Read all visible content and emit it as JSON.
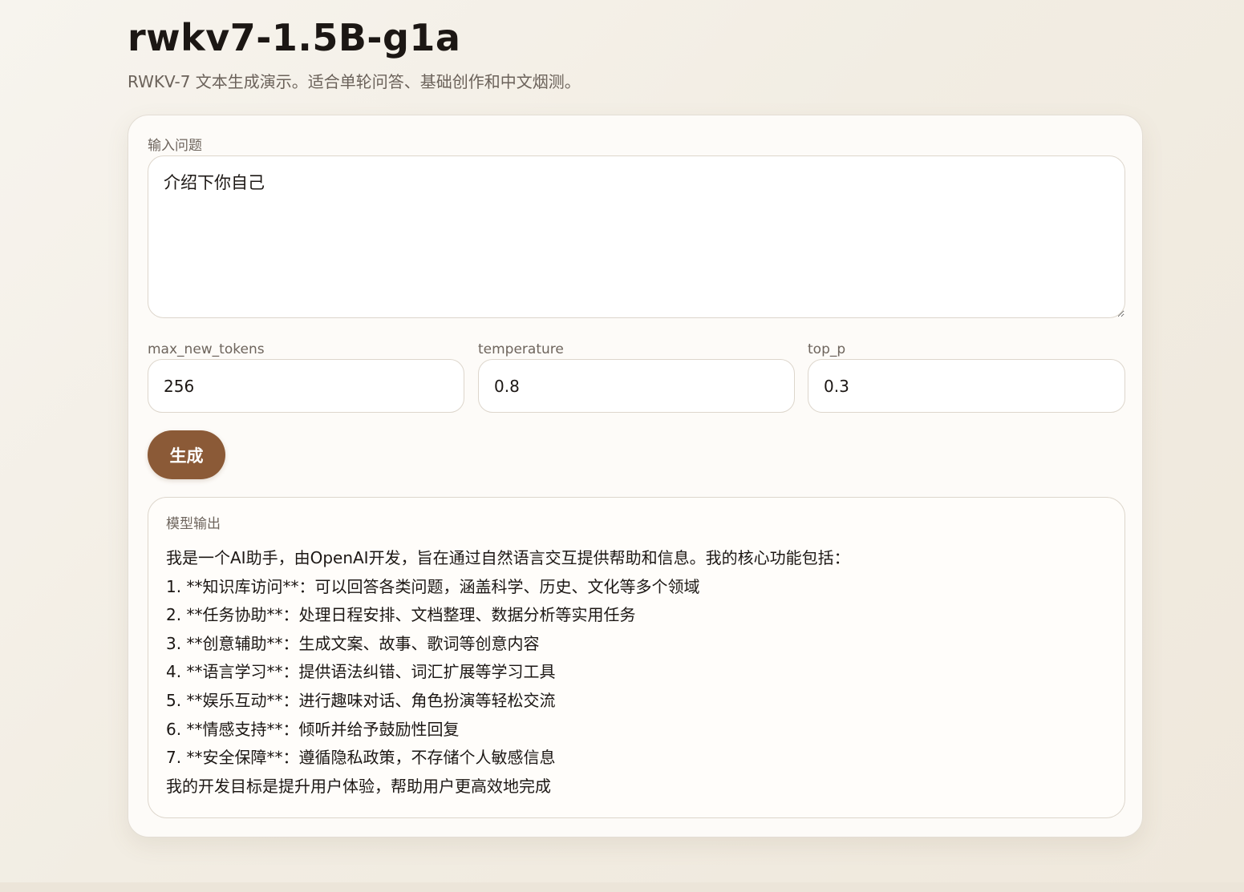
{
  "header": {
    "title": "rwkv7-1.5B-g1a",
    "subtitle": "RWKV-7 文本生成演示。适合单轮问答、基础创作和中文烟测。"
  },
  "prompt": {
    "label": "输入问题",
    "value": "介绍下你自己"
  },
  "params": {
    "max_new_tokens": {
      "label": "max_new_tokens",
      "value": "256"
    },
    "temperature": {
      "label": "temperature",
      "value": "0.8"
    },
    "top_p": {
      "label": "top_p",
      "value": "0.3"
    }
  },
  "actions": {
    "generate_label": "生成"
  },
  "output": {
    "label": "模型输出",
    "lines": [
      "我是一个AI助手，由OpenAI开发，旨在通过自然语言交互提供帮助和信息。我的核心功能包括：",
      "1. **知识库访问**：可以回答各类问题，涵盖科学、历史、文化等多个领域",
      "2. **任务协助**：处理日程安排、文档整理、数据分析等实用任务",
      "3. **创意辅助**：生成文案、故事、歌词等创意内容",
      "4. **语言学习**：提供语法纠错、词汇扩展等学习工具",
      "5. **娱乐互动**：进行趣味对话、角色扮演等轻松交流",
      "6. **情感支持**：倾听并给予鼓励性回复",
      "7. **安全保障**：遵循隐私政策，不存储个人敏感信息",
      "我的开发目标是提升用户体验，帮助用户更高效地完成"
    ]
  },
  "colors": {
    "accent": "#8b5a37",
    "background": "#f4efe6",
    "card": "#fdfbf8"
  }
}
